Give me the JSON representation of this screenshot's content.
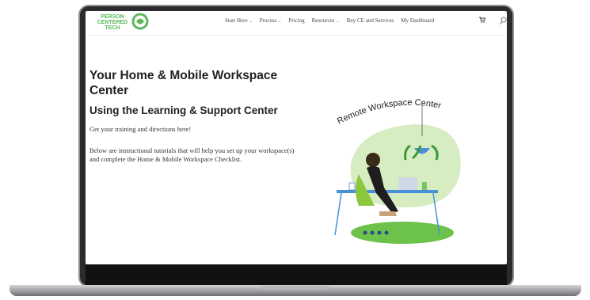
{
  "logo": {
    "line1": "PERSON",
    "line2": "CENTERED",
    "line3": "TECH"
  },
  "nav": {
    "items": [
      {
        "label": "Start Here",
        "dropdown": true
      },
      {
        "label": "Process",
        "dropdown": true
      },
      {
        "label": "Pricing",
        "dropdown": false
      },
      {
        "label": "Resources",
        "dropdown": true
      },
      {
        "label": "Buy CE and Services",
        "dropdown": false
      },
      {
        "label": "My Dashboard",
        "dropdown": false
      }
    ],
    "caret": "⌄"
  },
  "main": {
    "title": "Your Home & Mobile Workspace Center",
    "subtitle": "Using the Learning & Support Center",
    "intro": "Get your training and directions here!",
    "body": "Below are instructional tutorials that will help you set up your workspace(s) and complete the Home & Mobile Workspace Checklist."
  },
  "illustration": {
    "caption": "Remote Workspace Center"
  },
  "icons": {
    "cart": "cart-icon",
    "search": "search-icon"
  },
  "colors": {
    "brand_green": "#5cb85c",
    "blob_green": "#d6ecc1",
    "mat_green": "#6cc24a",
    "desk_blue": "#4a90d9"
  }
}
